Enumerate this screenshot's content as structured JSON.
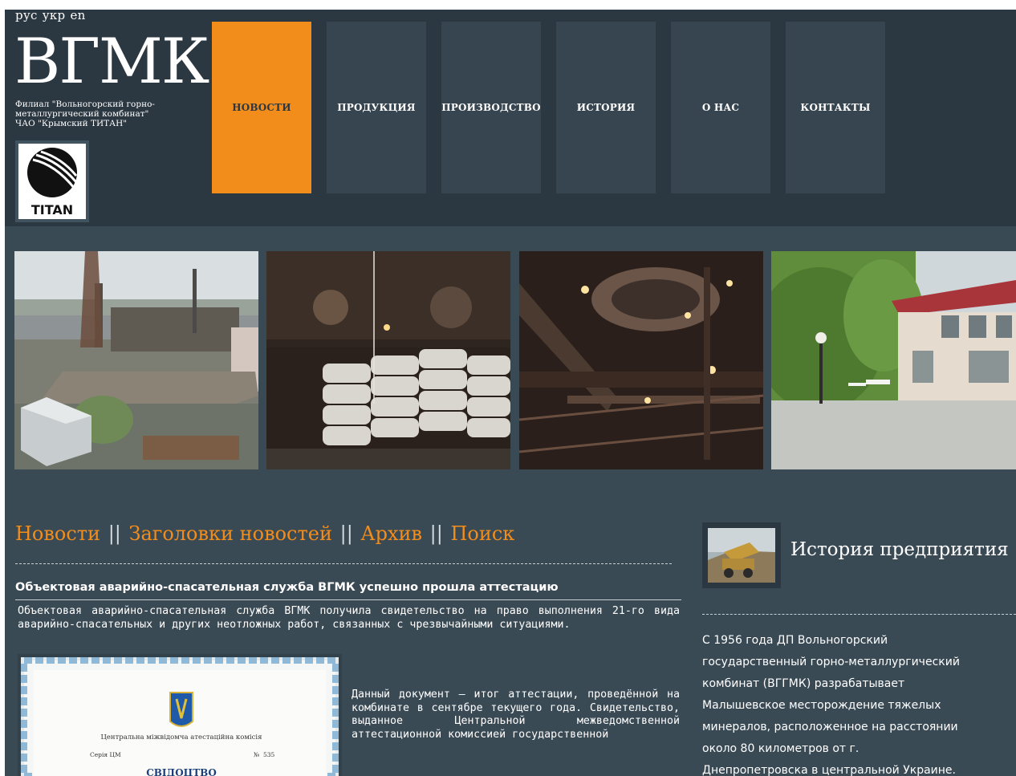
{
  "header": {
    "languages": [
      "рус",
      "укр",
      "en"
    ],
    "logo_text": "ВГМК",
    "tagline_lines": [
      "Филиал \"Вольногорский горно-",
      "металлургический комбинат\"",
      "ЧАО \"Крымский ТИТАН\""
    ],
    "partner_logo_text": "TITAN",
    "nav": [
      {
        "label": "НОВОСТИ",
        "active": true
      },
      {
        "label": "ПРОДУКЦИЯ",
        "active": false
      },
      {
        "label": "ПРОИЗВОДСТВО",
        "active": false
      },
      {
        "label": "ИСТОРИЯ",
        "active": false
      },
      {
        "label": "О НАС",
        "active": false
      },
      {
        "label": "КОНТАКТЫ",
        "active": false
      }
    ]
  },
  "gallery": [
    {
      "subject": "industrial-plant-aerial"
    },
    {
      "subject": "sacks-in-warehouse"
    },
    {
      "subject": "furnace-interior"
    },
    {
      "subject": "administration-building"
    }
  ],
  "news": {
    "links": [
      "Новости",
      "Заголовки новостей",
      "Архив",
      "Поиск"
    ],
    "separator": "||",
    "article": {
      "title": "Объектовая аварийно-спасательная служба ВГМК успешно прошла аттестацию",
      "lead": "Объектовая аварийно-спасательная служба ВГМК получила свидетельство на право выполнения 21-го вида аварийно-спасательных и других неотложных работ, связанных с чрезвычайными ситуациями.",
      "body": "Данный документ – итог аттестации, проведённой на комбинате в сентябре текущего года. Свидетельство, выданное Центральной межведомственной аттестационной комиссией государственной",
      "certificate": {
        "commission": "Центральна міжвідомча атестаційна комісія",
        "series": "Серія ЦМ",
        "number_label": "№",
        "number": "535",
        "doc_title": "СВІДОЦТВО"
      }
    }
  },
  "history": {
    "title": "История предприятия",
    "text_lines": [
      "С 1956 года ДП Вольногорский",
      "государственный горно-металлургический",
      "комбинат (ВГГМК) разрабатывает",
      "Малышевское месторождение тяжелых",
      "минералов, расположенное на расстоянии",
      "около 80 километров от г.",
      "Днепропетровска в центральной Украине."
    ]
  },
  "colors": {
    "page_bg": "#3a4a55",
    "header_bg": "#2b3741",
    "nav_tile": "#364550",
    "accent": "#f28d1c",
    "text": "#ffffff"
  }
}
